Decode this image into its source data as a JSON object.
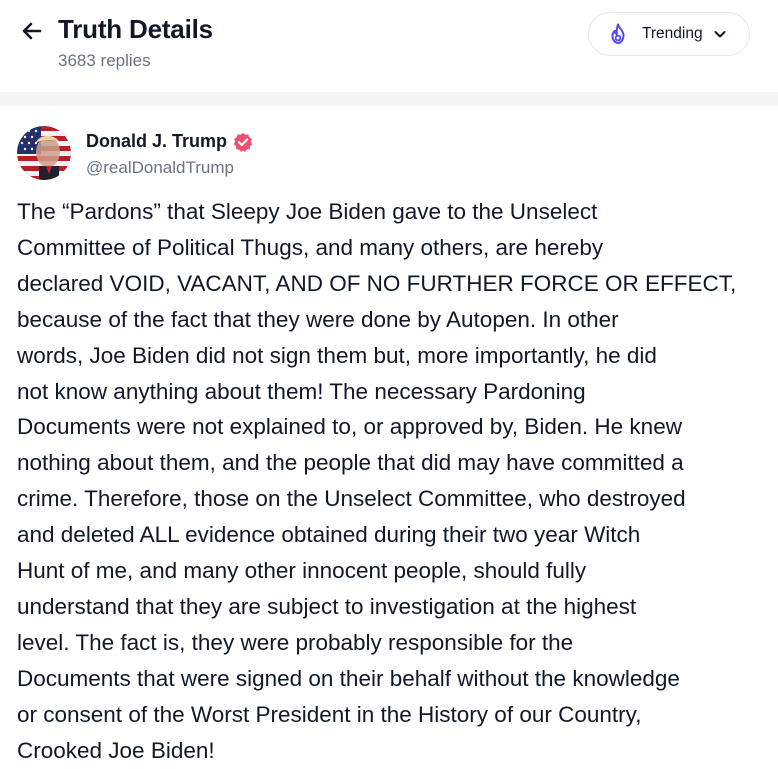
{
  "header": {
    "title": "Truth Details",
    "replies": "3683 replies",
    "back_icon": "arrow-left-icon",
    "sort": {
      "label": "Trending",
      "icon": "flame-icon",
      "caret_icon": "chevron-down-icon",
      "accent": "#5448ee"
    }
  },
  "post": {
    "author": {
      "name": "Donald J. Trump",
      "handle": "@realDonaldTrump",
      "verified": true,
      "verified_color": "#ef4d72"
    },
    "lines": [
      "The “Pardons” that Sleepy Joe Biden gave to the Unselect",
      "Committee of Political Thugs, and many others, are hereby",
      "declared VOID, VACANT, AND OF NO FURTHER FORCE OR EFFECT,",
      "because of the fact that they were done by Autopen. In other",
      "words, Joe Biden did not sign them but, more importantly, he did",
      "not know anything about them! The necessary Pardoning",
      "Documents were not explained to, or approved by, Biden. He knew",
      "nothing about them, and the people that did may have committed a",
      "crime. Therefore, those on the Unselect Committee, who destroyed",
      "and deleted ALL evidence obtained during their two year Witch",
      "Hunt of me, and many other innocent people, should fully",
      "understand that they are subject to investigation at the highest",
      "level. The fact is, they were probably responsible for the",
      "Documents that were signed on their behalf without the knowledge",
      "or consent of the Worst President in the History of our Country,",
      "Crooked Joe Biden!"
    ]
  }
}
